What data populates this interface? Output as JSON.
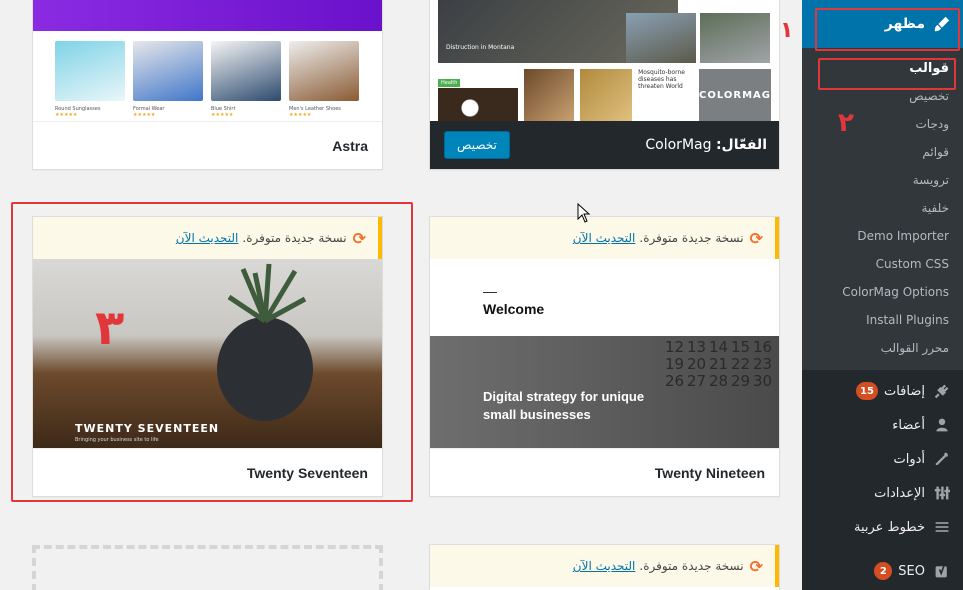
{
  "sidebar": {
    "appearance": "مظهر",
    "submenu": [
      "قوالب",
      "تخصيص",
      "ودجات",
      "قوائم",
      "ترويسة",
      "خلفية",
      "Demo Importer",
      "Custom CSS",
      "ColorMag Options",
      "Install Plugins",
      "محرر القوالب"
    ],
    "plugins": {
      "label": "إضافات",
      "count": "15"
    },
    "users": "أعضاء",
    "tools": "أدوات",
    "settings": "الإعدادات",
    "fonts": "خطوط عربية",
    "seo": {
      "label": "SEO",
      "count": "2"
    }
  },
  "themes": {
    "astra": {
      "name": "Astra",
      "products": [
        "Round Sunglasses",
        "Formal Wear",
        "Blue Shirt",
        "Men's Leather Shoes"
      ],
      "stars": "★★★★★"
    },
    "colormag": {
      "active_prefix": "الفعّال:",
      "name": "ColorMag",
      "customize": "تخصيص",
      "headline": "Distruction in Montana",
      "mosquito": "Mosquito-borne diseases has threaten World",
      "logo": "COLORMAG",
      "health_tag": "Health"
    },
    "seventeen": {
      "name": "Twenty Seventeen",
      "brand": "TWENTY SEVENTEEN",
      "tagline": "Bringing your business site to life"
    },
    "nineteen": {
      "name": "Twenty Nineteen",
      "welcome": "Welcome",
      "headline": "Digital strategy for unique small businesses"
    }
  },
  "update_notice": {
    "text": "نسخة جديدة متوفرة.",
    "link": "التحديث الآن"
  },
  "annotations": [
    "١",
    "٢",
    "٣"
  ],
  "colors": {
    "accent": "#0073aa",
    "annotation": "#e2373a",
    "sidebar": "#23282d"
  }
}
